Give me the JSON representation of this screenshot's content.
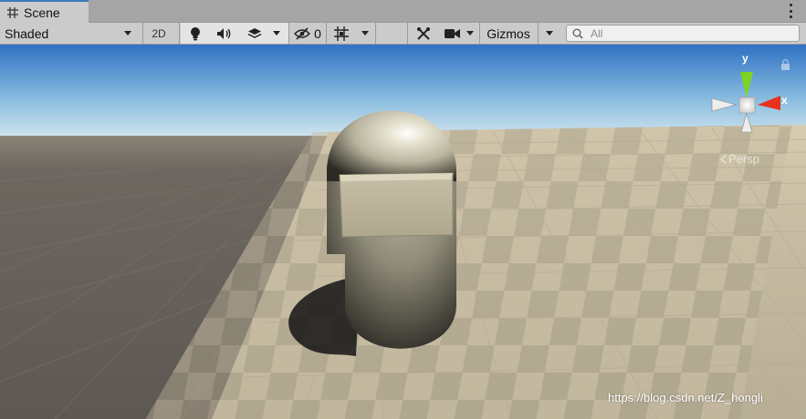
{
  "tab": {
    "icon": "grid-icon",
    "label": "Scene"
  },
  "toolbar": {
    "shading_mode": "Shaded",
    "mode_2d": "2D",
    "hidden_count": "0",
    "gizmos_label": "Gizmos",
    "search_placeholder": "All"
  },
  "scene": {
    "projection_label": "Persp",
    "gizmo_axes": {
      "y": "y",
      "x": "x"
    },
    "watermark": "https://blog.csdn.net/Z_hongli"
  },
  "colors": {
    "sky_top": "#2f72c4",
    "horizon": "#e6f0f4",
    "ground_dark": "#655f5a",
    "tile_light": "#c9bea4",
    "tile_dark": "#a59d87",
    "capsule": "#c9c4ae",
    "visor": "#bdb59c",
    "axis_y": "#7ed321",
    "axis_x": "#e8321e",
    "tab_accent": "#3a79bb"
  }
}
